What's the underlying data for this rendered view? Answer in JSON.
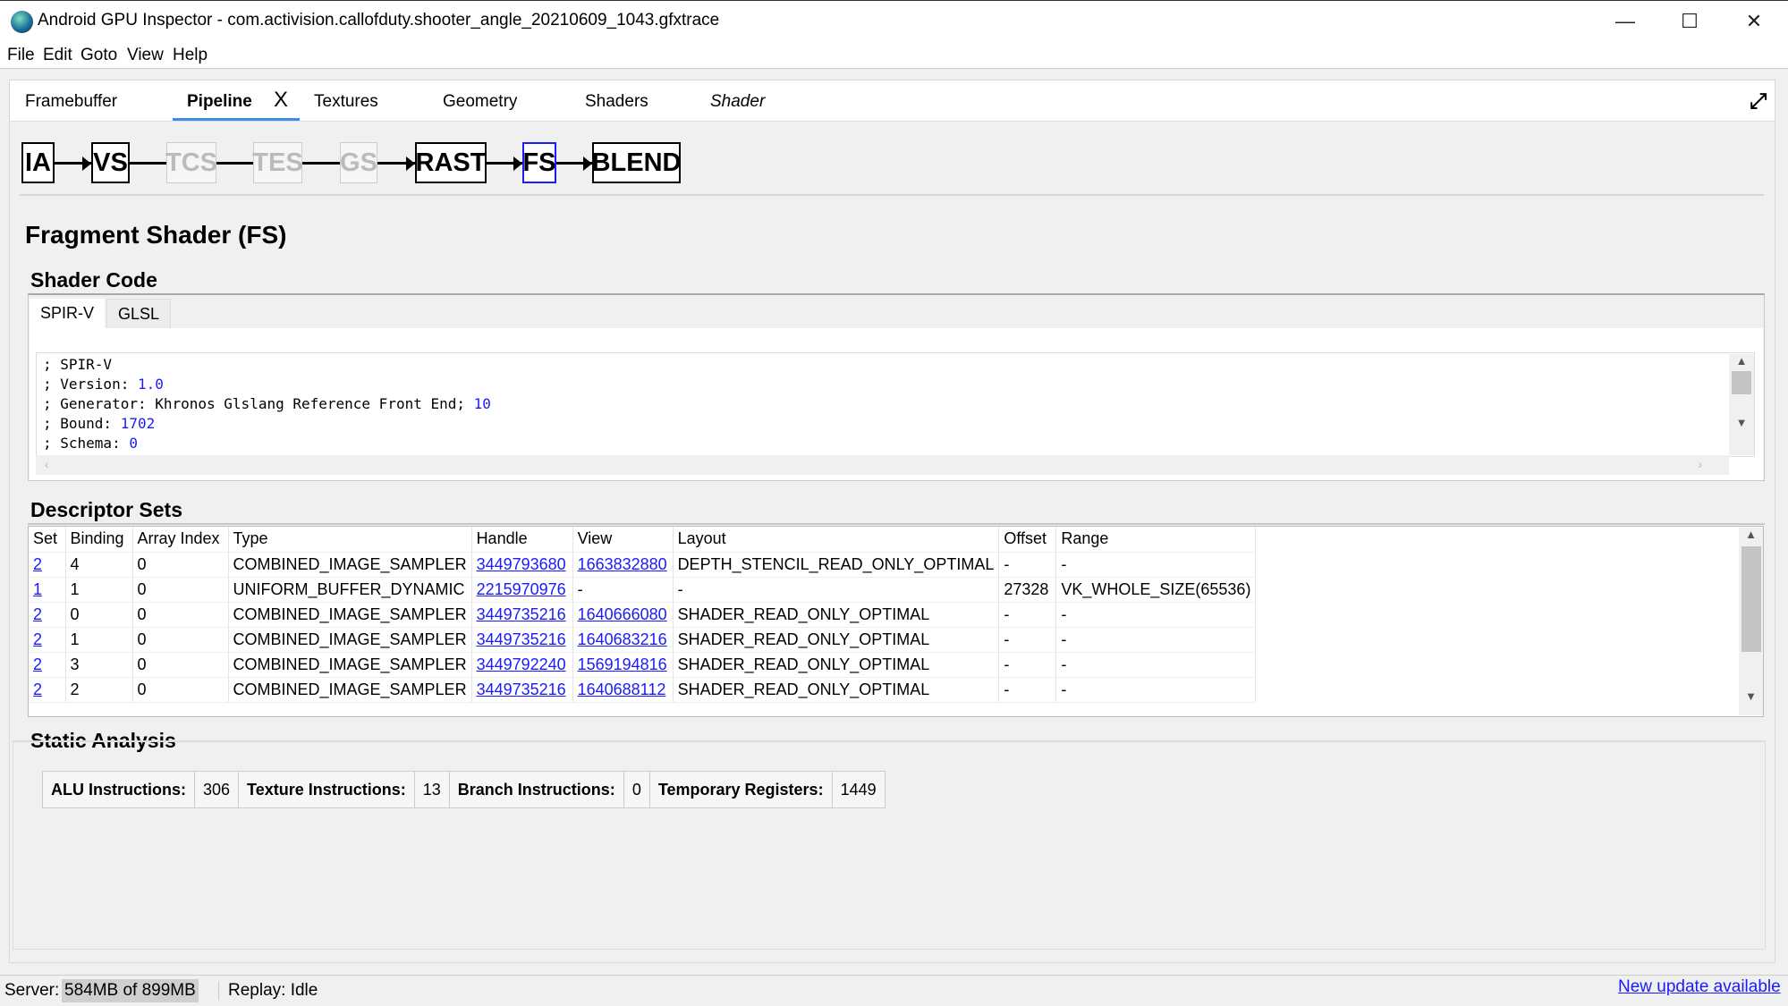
{
  "window": {
    "title": "Android GPU Inspector - com.activision.callofduty.shooter_angle_20210609_1043.gfxtrace",
    "controls": [
      "minimize-icon",
      "maximize-icon",
      "close-icon"
    ]
  },
  "menu": [
    "File",
    "Edit",
    "Goto",
    "View",
    "Help"
  ],
  "tabs": [
    {
      "label": "Framebuffer"
    },
    {
      "label": "Pipeline",
      "active": true
    },
    {
      "label": "Textures"
    },
    {
      "label": "Geometry"
    },
    {
      "label": "Shaders"
    },
    {
      "label": "Shader",
      "italic": true
    }
  ],
  "tab_close": "X",
  "pipeline": {
    "stages": [
      {
        "label": "IA",
        "state": "active"
      },
      {
        "label": "VS",
        "state": "active"
      },
      {
        "label": "TCS",
        "state": "disabled"
      },
      {
        "label": "TES",
        "state": "disabled"
      },
      {
        "label": "GS",
        "state": "disabled"
      },
      {
        "label": "RAST",
        "state": "active"
      },
      {
        "label": "FS",
        "state": "selected"
      },
      {
        "label": "BLEND",
        "state": "active"
      }
    ]
  },
  "page_title": "Fragment Shader (FS)",
  "shader_code": {
    "heading": "Shader Code",
    "tabs": [
      "SPIR-V",
      "GLSL"
    ],
    "active_tab": "SPIR-V",
    "lines": [
      {
        "text": "; SPIR-V",
        "num": ""
      },
      {
        "text": "; Version: ",
        "num": "1.0"
      },
      {
        "text": "; Generator: Khronos Glslang Reference Front End; ",
        "num": "10"
      },
      {
        "text": "; Bound: ",
        "num": "1702"
      },
      {
        "text": "; Schema: ",
        "num": "0"
      }
    ]
  },
  "descriptor_sets": {
    "heading": "Descriptor Sets",
    "columns": [
      "Set",
      "Binding",
      "Array Index",
      "Type",
      "Handle",
      "View",
      "Layout",
      "Offset",
      "Range"
    ],
    "rows": [
      [
        "2",
        "4",
        "0",
        "COMBINED_IMAGE_SAMPLER",
        "3449793680",
        "1663832880",
        "DEPTH_STENCIL_READ_ONLY_OPTIMAL",
        "-",
        "-"
      ],
      [
        "1",
        "1",
        "0",
        "UNIFORM_BUFFER_DYNAMIC",
        "2215970976",
        "-",
        "-",
        "27328",
        "VK_WHOLE_SIZE(65536)"
      ],
      [
        "2",
        "0",
        "0",
        "COMBINED_IMAGE_SAMPLER",
        "3449735216",
        "1640666080",
        "SHADER_READ_ONLY_OPTIMAL",
        "-",
        "-"
      ],
      [
        "2",
        "1",
        "0",
        "COMBINED_IMAGE_SAMPLER",
        "3449735216",
        "1640683216",
        "SHADER_READ_ONLY_OPTIMAL",
        "-",
        "-"
      ],
      [
        "2",
        "3",
        "0",
        "COMBINED_IMAGE_SAMPLER",
        "3449792240",
        "1569194816",
        "SHADER_READ_ONLY_OPTIMAL",
        "-",
        "-"
      ],
      [
        "2",
        "2",
        "0",
        "COMBINED_IMAGE_SAMPLER",
        "3449735216",
        "1640688112",
        "SHADER_READ_ONLY_OPTIMAL",
        "-",
        "-"
      ]
    ]
  },
  "static_analysis": {
    "heading": "Static Analysis",
    "items": [
      {
        "label": "ALU Instructions:",
        "value": "306"
      },
      {
        "label": "Texture Instructions:",
        "value": "13"
      },
      {
        "label": "Branch Instructions:",
        "value": "0"
      },
      {
        "label": "Temporary Registers:",
        "value": "1449"
      }
    ]
  },
  "status": {
    "server_label": "Server:",
    "server_value": "584MB of 899MB",
    "replay": "Replay: Idle",
    "update_link": "New update available"
  },
  "colors": {
    "link": "#1a1aff",
    "selected_stage": "#1a1aff",
    "tab_underline": "#3c8ee6"
  }
}
